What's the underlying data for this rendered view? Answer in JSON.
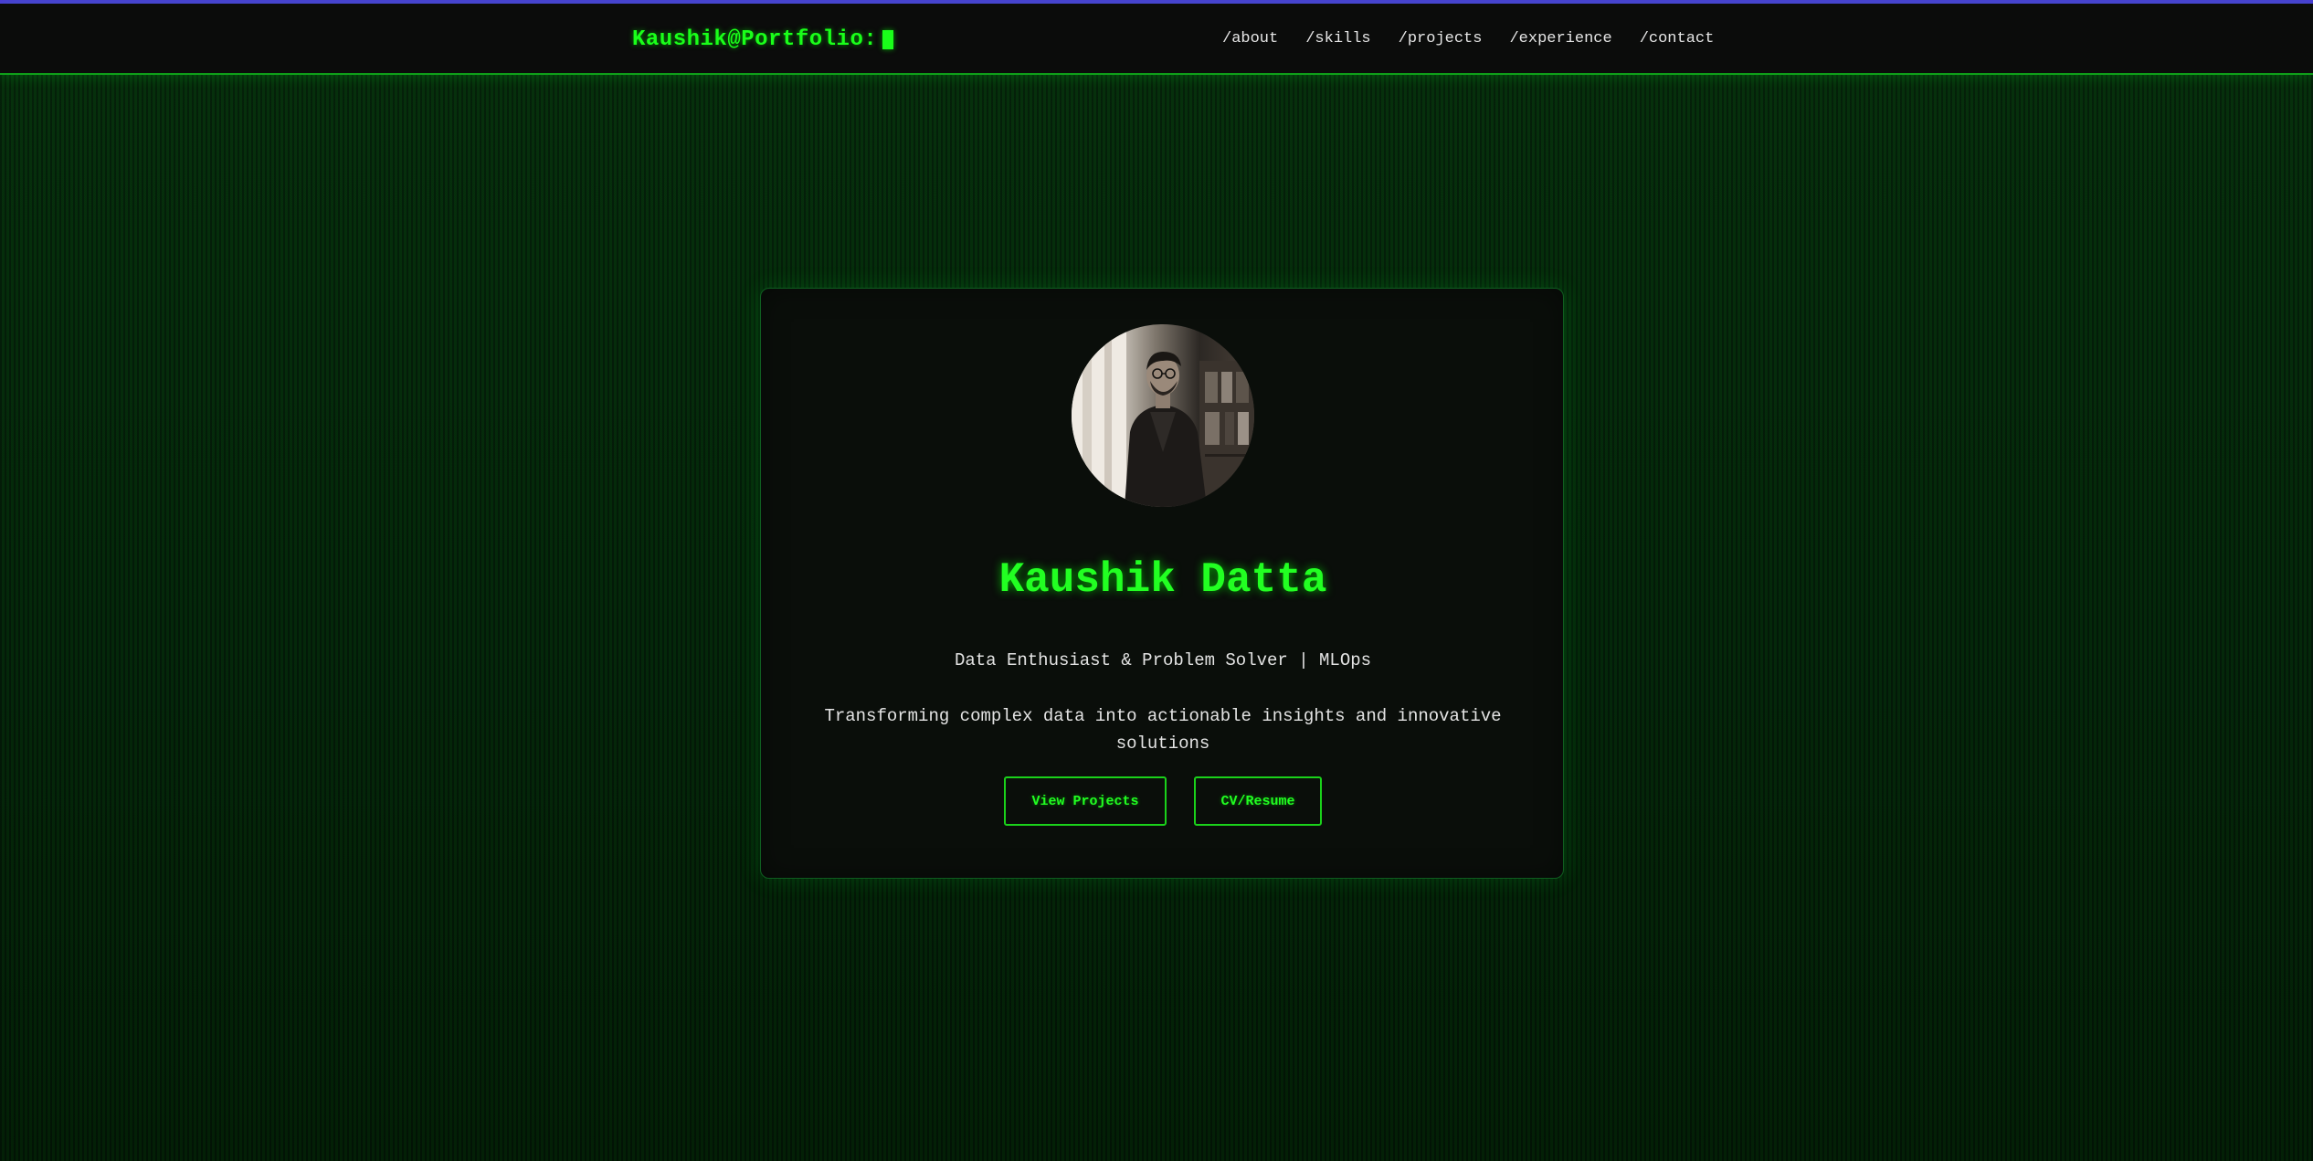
{
  "header": {
    "brand": "Kaushik@Portfolio:",
    "nav": [
      {
        "label": "/about"
      },
      {
        "label": "/skills"
      },
      {
        "label": "/projects"
      },
      {
        "label": "/experience"
      },
      {
        "label": "/contact"
      }
    ]
  },
  "hero": {
    "avatar_icon": "profile-photo",
    "name": "Kaushik Datta",
    "tagline": "Data Enthusiast & Problem Solver | MLOps",
    "description": "Transforming complex data into actionable insights and innovative solutions",
    "buttons": {
      "projects_label": "View Projects",
      "cv_label": "CV/Resume"
    }
  },
  "colors": {
    "accent": "#22ff22",
    "top_bar": "#4a3ad8",
    "background": "#041a08",
    "card": "#0a0e0a"
  }
}
